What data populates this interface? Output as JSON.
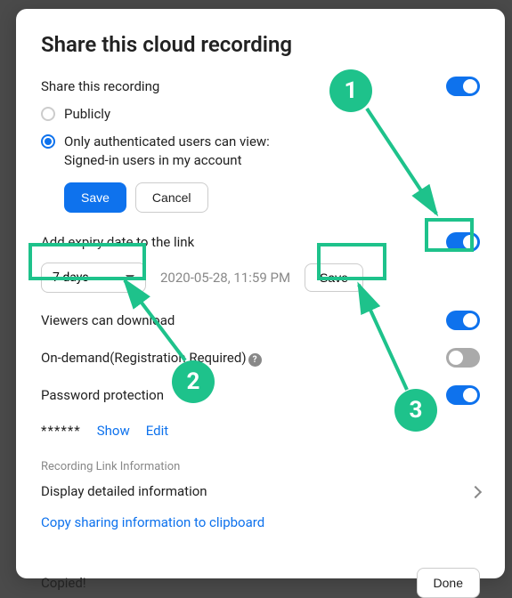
{
  "title": "Share this cloud recording",
  "share_section": {
    "label": "Share this recording",
    "publicly": "Publicly",
    "auth_only_line1": "Only authenticated users can view:",
    "auth_only_line2": "Signed-in users in my account",
    "save": "Save",
    "cancel": "Cancel"
  },
  "expiry": {
    "label": "Add expiry date to the link",
    "select_value": "7 days",
    "date_display": "2020-05-28, 11:59 PM",
    "save": "Save"
  },
  "settings": {
    "download": "Viewers can download",
    "ondemand": "On-demand(Registration Required)",
    "password": "Password protection",
    "password_value": "******",
    "show": "Show",
    "edit": "Edit"
  },
  "link_info": {
    "header": "Recording Link Information",
    "detail": "Display detailed information",
    "copy": "Copy sharing information to clipboard"
  },
  "footer": {
    "copied": "Copied!",
    "done": "Done"
  },
  "annotations": {
    "step1": "1",
    "step2": "2",
    "step3": "3"
  },
  "toggles": {
    "share": true,
    "expiry": true,
    "download": true,
    "ondemand": false,
    "password": true
  }
}
